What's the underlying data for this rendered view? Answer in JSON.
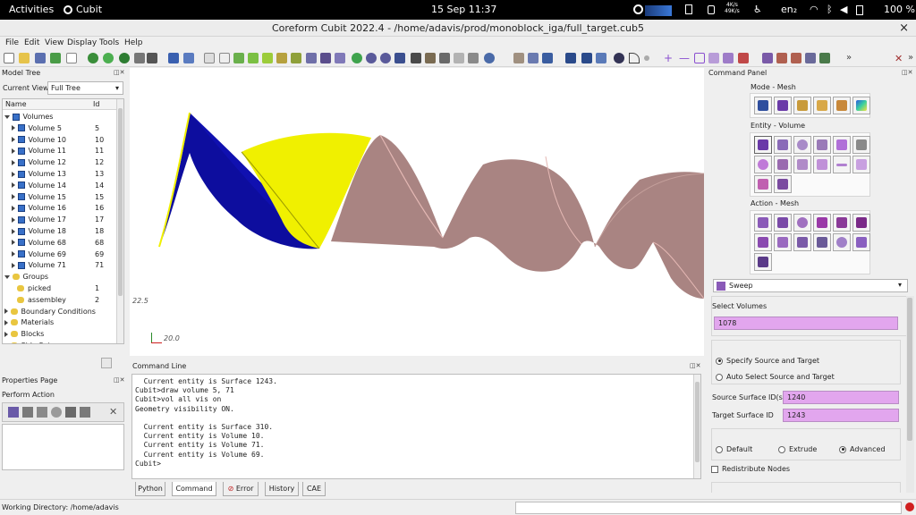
{
  "topbar": {
    "activities": "Activities",
    "app": "Cubit",
    "clock": "15 Sep 11:37",
    "net_up": "4K/s",
    "net_down": "49K/s",
    "keyboard": "en₂",
    "battery": "100 %"
  },
  "window": {
    "title": "Coreform Cubit 2022.4 - /home/adavis/prod/monoblock_iga/full_target.cub5",
    "close": "×"
  },
  "menu": [
    "File",
    "Edit",
    "View",
    "Display",
    "Tools",
    "Help"
  ],
  "model_tree": {
    "title": "Model Tree",
    "current_view_label": "Current View",
    "current_view_value": "Full Tree",
    "col_name": "Name",
    "col_id": "Id",
    "volumes_label": "Volumes",
    "volumes": [
      {
        "name": "Volume 5",
        "id": "5"
      },
      {
        "name": "Volume 10",
        "id": "10"
      },
      {
        "name": "Volume 11",
        "id": "11"
      },
      {
        "name": "Volume 12",
        "id": "12"
      },
      {
        "name": "Volume 13",
        "id": "13"
      },
      {
        "name": "Volume 14",
        "id": "14"
      },
      {
        "name": "Volume 15",
        "id": "15"
      },
      {
        "name": "Volume 16",
        "id": "16"
      },
      {
        "name": "Volume 17",
        "id": "17"
      },
      {
        "name": "Volume 18",
        "id": "18"
      },
      {
        "name": "Volume 68",
        "id": "68"
      },
      {
        "name": "Volume 69",
        "id": "69"
      },
      {
        "name": "Volume 71",
        "id": "71"
      }
    ],
    "groups_label": "Groups",
    "groups": [
      {
        "name": "picked",
        "id": "1"
      },
      {
        "name": "assembley",
        "id": "2"
      }
    ],
    "other": [
      "Boundary Conditions",
      "Materials",
      "Blocks",
      "Side Sets"
    ]
  },
  "properties": {
    "title": "Properties Page",
    "perform_action": "Perform Action"
  },
  "viewport": {
    "scale_label": "22.5",
    "axis_label": "20.0"
  },
  "command_line": {
    "title": "Command Line",
    "lines": [
      "  Current entity is Surface 1243.",
      "Cubit>draw volume 5, 71",
      "Cubit>vol all vis on",
      "Geometry visibility ON.",
      "",
      "  Current entity is Surface 310.",
      "  Current entity is Volume 10.",
      "  Current entity is Volume 71.",
      "  Current entity is Volume 69.",
      "Cubit>"
    ],
    "tabs": [
      "Python",
      "Command",
      "Error",
      "History",
      "CAE"
    ]
  },
  "status": {
    "working_dir": "Working Directory: /home/adavis"
  },
  "command_panel": {
    "title": "Command Panel",
    "mode_label": "Mode - Mesh",
    "entity_label": "Entity - Volume",
    "action_label": "Action - Mesh",
    "scheme": "Sweep",
    "select_volumes_label": "Select Volumes",
    "select_volumes_value": "1078",
    "radio_specify": "Specify Source and Target",
    "radio_auto": "Auto Select Source and Target",
    "source_label": "Source Surface ID(s)",
    "source_value": "1240",
    "target_label": "Target Surface ID",
    "target_value": "1243",
    "opt_default": "Default",
    "opt_extrude": "Extrude",
    "opt_advanced": "Advanced",
    "redistribute": "Redistribute Nodes"
  },
  "colors": {
    "accent_field": "#e2a6ee",
    "blue_surface": "#1010b0",
    "yellow_surface": "#f0f000",
    "body_surface": "#a98482"
  }
}
